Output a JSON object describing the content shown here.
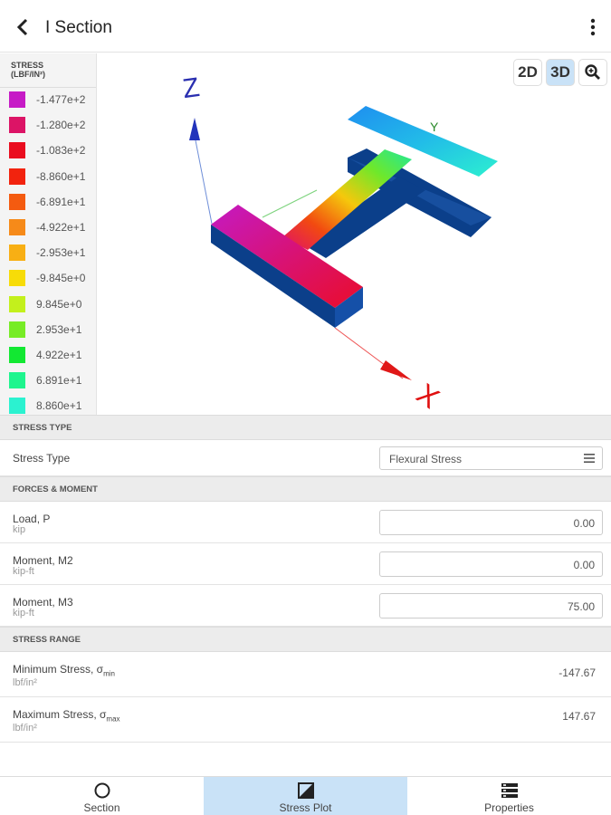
{
  "header": {
    "title": "I Section",
    "back_icon": "back-arrow-icon",
    "menu_icon": "more-vert-icon"
  },
  "legend": {
    "title": "STRESS",
    "unit": "(LBF/IN²)",
    "items": [
      {
        "value": "-1.477e+2",
        "color": "#c61bc6"
      },
      {
        "value": "-1.280e+2",
        "color": "#dc1466"
      },
      {
        "value": "-1.083e+2",
        "color": "#ea0d1f"
      },
      {
        "value": "-8.860e+1",
        "color": "#f2230e"
      },
      {
        "value": "-6.891e+1",
        "color": "#f45b10"
      },
      {
        "value": "-4.922e+1",
        "color": "#f68a19"
      },
      {
        "value": "-2.953e+1",
        "color": "#f8af14"
      },
      {
        "value": "-9.845e+0",
        "color": "#f7dc08"
      },
      {
        "value": "9.845e+0",
        "color": "#c3f01c"
      },
      {
        "value": "2.953e+1",
        "color": "#77ec26"
      },
      {
        "value": "4.922e+1",
        "color": "#12e832"
      },
      {
        "value": "6.891e+1",
        "color": "#1ef58e"
      },
      {
        "value": "8.860e+1",
        "color": "#2bf2d0"
      }
    ]
  },
  "view_controls": {
    "btn_2d": "2D",
    "btn_3d": "3D",
    "active": "3D",
    "zoom_icon": "zoom-in-icon"
  },
  "axes": {
    "x": "X",
    "y": "Y",
    "z": "Z"
  },
  "stress_type": {
    "heading": "STRESS TYPE",
    "label": "Stress Type",
    "value": "Flexural Stress"
  },
  "forces": {
    "heading": "FORCES & MOMENT",
    "items": [
      {
        "label": "Load, P",
        "unit": "kip",
        "value": "0.00"
      },
      {
        "label": "Moment, M2",
        "unit": "kip-ft",
        "value": "0.00"
      },
      {
        "label": "Moment, M3",
        "unit": "kip-ft",
        "value": "75.00"
      }
    ]
  },
  "stress_range": {
    "heading": "STRESS RANGE",
    "min": {
      "label": "Minimum Stress, σ",
      "sub": "min",
      "unit": "lbf/in²",
      "value": "-147.67"
    },
    "max": {
      "label": "Maximum Stress, σ",
      "sub": "max",
      "unit": "lbf/in²",
      "value": "147.67"
    }
  },
  "nav": {
    "active": "Stress Plot",
    "items": [
      {
        "label": "Section",
        "icon": "circle-section-icon"
      },
      {
        "label": "Stress Plot",
        "icon": "stress-plot-icon"
      },
      {
        "label": "Properties",
        "icon": "properties-list-icon"
      }
    ]
  }
}
